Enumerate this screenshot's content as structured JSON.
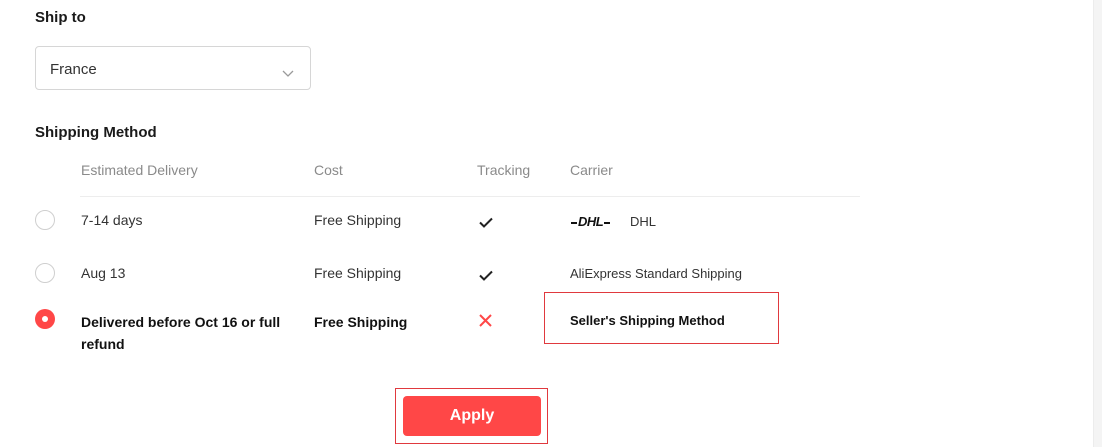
{
  "ship_to": {
    "title": "Ship to",
    "selected_country": "France",
    "chevron_icon": "chevron-down-icon"
  },
  "shipping_method": {
    "title": "Shipping Method",
    "columns": [
      "Estimated Delivery",
      "Cost",
      "Tracking",
      "Carrier"
    ],
    "options": [
      {
        "delivery": "7-14 days",
        "cost": "Free Shipping",
        "tracking": "check-icon",
        "carrier_logo": "DHL",
        "carrier": "DHL",
        "selected": false
      },
      {
        "delivery": "Aug 13",
        "cost": "Free Shipping",
        "tracking": "check-icon",
        "carrier": "AliExpress Standard Shipping",
        "selected": false
      },
      {
        "delivery_line1": "Delivered before Oct 16 or full",
        "delivery_line2": "refund",
        "cost": "Free Shipping",
        "tracking": "cross-icon",
        "carrier": "Seller's Shipping Method",
        "selected": true
      }
    ]
  },
  "apply_label": "Apply",
  "colors": {
    "accent": "#ff4747",
    "highlight": "#e0393e"
  }
}
